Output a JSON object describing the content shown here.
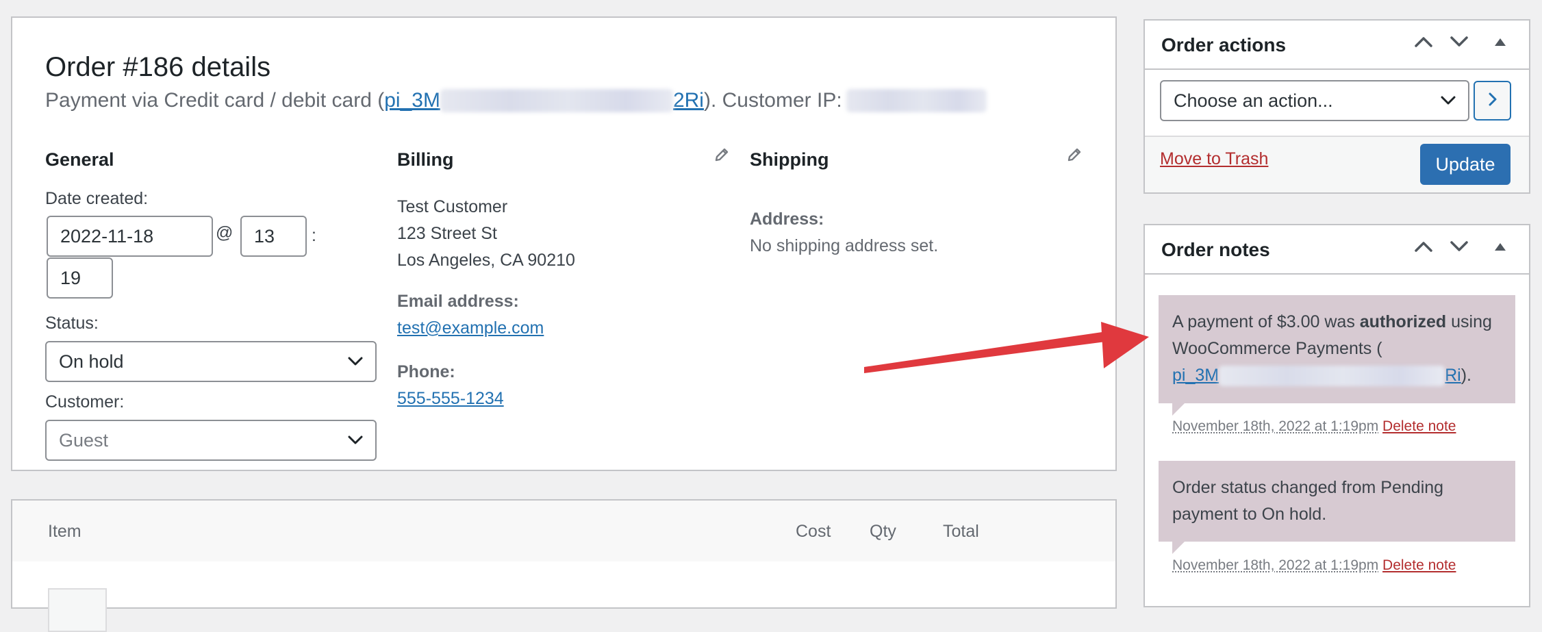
{
  "order": {
    "title": "Order #186 details",
    "payment_prefix": "Payment via Credit card / debit card (",
    "payment_id_start": "pi_3M",
    "payment_id_end": "2Ri",
    "payment_suffix": "). Customer IP:"
  },
  "general": {
    "heading": "General",
    "date_label": "Date created:",
    "date_value": "2022-11-18",
    "at_symbol": "@",
    "hour_value": "13",
    "colon": ":",
    "minute_value": "19",
    "status_label": "Status:",
    "status_value": "On hold",
    "customer_label": "Customer:",
    "customer_value": "Guest"
  },
  "billing": {
    "heading": "Billing",
    "name": "Test Customer",
    "street": "123 Street St",
    "city_line": "Los Angeles, CA 90210",
    "email_label": "Email address:",
    "email": "test@example.com",
    "phone_label": "Phone:",
    "phone": "555-555-1234"
  },
  "shipping": {
    "heading": "Shipping",
    "address_label": "Address:",
    "address_value": "No shipping address set."
  },
  "items_table": {
    "columns": [
      "Item",
      "Cost",
      "Qty",
      "Total"
    ]
  },
  "order_actions": {
    "title": "Order actions",
    "select_placeholder": "Choose an action...",
    "trash_label": "Move to Trash",
    "update_label": "Update"
  },
  "order_notes": {
    "title": "Order notes",
    "notes": [
      {
        "text_before": "A payment of $3.00 was ",
        "text_bold": "authorized",
        "text_after": " using WooCommerce Payments (",
        "link_start": "pi_3M",
        "link_end": "Ri",
        "text_end": ").",
        "date": "November 18th, 2022 at 1:19pm",
        "delete_label": "Delete note"
      },
      {
        "text": "Order status changed from Pending payment to On hold.",
        "date": "November 18th, 2022 at 1:19pm",
        "delete_label": "Delete note"
      }
    ]
  },
  "colors": {
    "accent": "#2271b1",
    "update_button": "#2c6fb1",
    "trash_link": "#b32d2e",
    "note_bg": "#d7cad2",
    "arrow": "#e0393e"
  }
}
